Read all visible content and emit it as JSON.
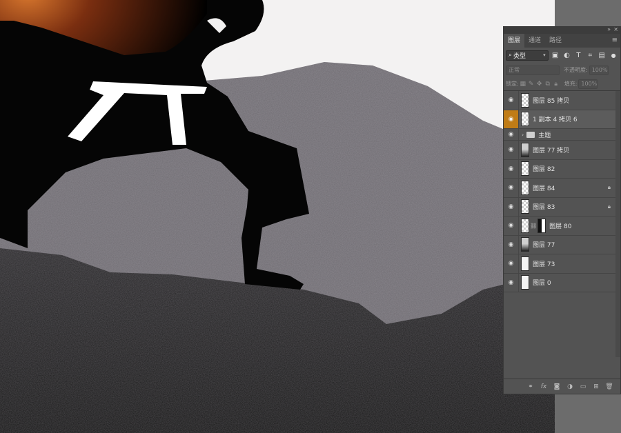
{
  "panel": {
    "tabs": [
      "图层",
      "通道",
      "路径"
    ],
    "filter": {
      "label": "类型"
    },
    "blend_mode": "正常",
    "opacity_label": "不透明度:",
    "opacity_value": "100%",
    "lock_label": "锁定:",
    "fill_label": "填充:",
    "fill_value": "100%"
  },
  "layers": [
    {
      "name": "图层 85 拷贝"
    },
    {
      "name": "1 副本 4 拷贝 6"
    },
    {
      "name": "主题"
    },
    {
      "name": "图层 77 拷贝"
    },
    {
      "name": "图层 82"
    },
    {
      "name": "图层 84"
    },
    {
      "name": "图层 83"
    },
    {
      "name": "图层 80"
    },
    {
      "name": "图层 77"
    },
    {
      "name": "图层 73"
    },
    {
      "name": "图层 0"
    }
  ],
  "colors": {
    "accent": "#c07c16",
    "panel_bg": "#535353"
  },
  "icons": {
    "filter": [
      "image-filter-icon",
      "adjustment-filter-icon",
      "type-filter-icon",
      "shape-filter-icon",
      "smart-object-filter-icon",
      "filter-toggle-icon"
    ],
    "lock": [
      "lock-transparent-icon",
      "lock-image-icon",
      "lock-position-icon",
      "lock-artboard-icon",
      "lock-all-icon"
    ],
    "footer": [
      "link-layers-icon",
      "fx-icon",
      "add-mask-icon",
      "adjustment-layer-icon",
      "new-group-icon",
      "new-layer-icon",
      "delete-layer-icon"
    ]
  }
}
